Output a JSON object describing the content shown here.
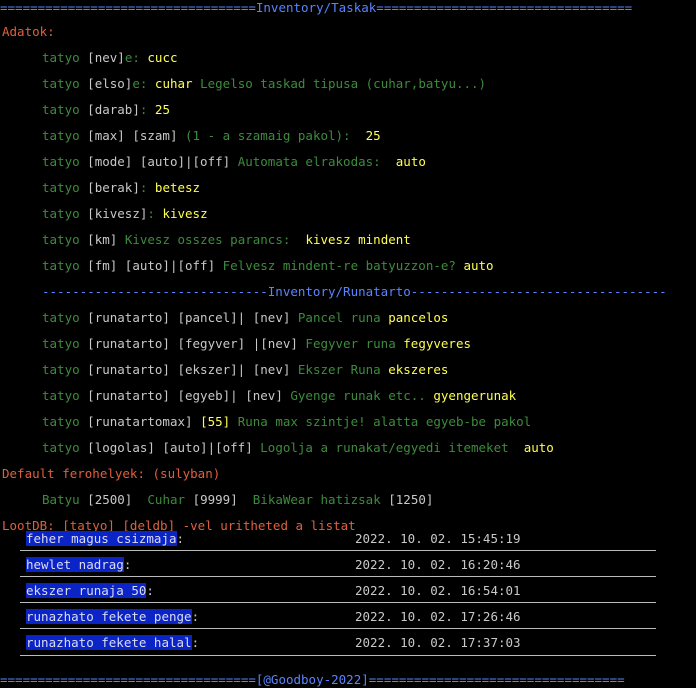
{
  "header": {
    "left_rule": "==================================",
    "title": "Inventory/Taskak",
    "right_rule": "=================================="
  },
  "adatok_label": "Adatok:",
  "commands": [
    {
      "kw": "tatyo",
      "cmd": "[nev]",
      "desc": "e:",
      "value": "cucc"
    },
    {
      "kw": "tatyo",
      "cmd": "[elso]",
      "desc": "e:",
      "value": "cuhar",
      "desc2": "Legelso taskad tipusa (cuhar,batyu...)"
    },
    {
      "kw": "tatyo",
      "cmd": "[darab]",
      "desc": ":",
      "value": "25"
    },
    {
      "kw": "tatyo",
      "cmd": "[max] [szam]",
      "desc": "(1 - a szamaig pakol):",
      "value": "25"
    },
    {
      "kw": "tatyo",
      "cmd": "[mode] [auto]|[off]",
      "desc": "Automata elrakodas:",
      "value": "auto"
    },
    {
      "kw": "tatyo",
      "cmd": "[berak]",
      "desc": ":",
      "value": "betesz"
    },
    {
      "kw": "tatyo",
      "cmd": "[kivesz]",
      "desc": ":",
      "value": "kivesz"
    },
    {
      "kw": "tatyo",
      "cmd": "[km]",
      "desc": "Kivesz osszes parancs:",
      "value": "kivesz mindent"
    },
    {
      "kw": "tatyo",
      "cmd": "[fm] [auto]|[off]",
      "desc": "Felvesz mindent-re batyuzzon-e?",
      "value": "auto"
    }
  ],
  "sub_header": {
    "left_rule": "------------------------------",
    "title": "Inventory/Runatarto",
    "right_rule": "----------------------------------"
  },
  "runa_commands": [
    {
      "kw": "tatyo",
      "cmd": "[runatarto] [pancel]| [nev]",
      "desc": "Pancel runa",
      "value": "pancelos"
    },
    {
      "kw": "tatyo",
      "cmd": "[runatarto] [fegyver] |[nev]",
      "desc": "Fegyver runa",
      "value": "fegyveres"
    },
    {
      "kw": "tatyo",
      "cmd": "[runatarto] [ekszer]| [nev]",
      "desc": "Ekszer Runa",
      "value": "ekszeres"
    },
    {
      "kw": "tatyo",
      "cmd": "[runatarto] [egyeb]| [nev]",
      "desc": "Gyenge runak etc..",
      "value": "gyengerunak"
    },
    {
      "kw": "tatyo",
      "cmd": "[runatartomax]",
      "num": "[55]",
      "desc": "Runa max szintje! alatta egyeb-be pakol"
    },
    {
      "kw": "tatyo",
      "cmd": "[logolas] [auto]|[off]",
      "desc": "Logolja a runakat/egyedi itemeket",
      "value": "auto"
    }
  ],
  "default_label": "Default ferohelyek: (sulyban)",
  "defaults": [
    {
      "name": "Batyu",
      "val": "[2500]"
    },
    {
      "name": "Cuhar",
      "val": "[9999]"
    },
    {
      "name": "BikaWear hatizsak",
      "val": "[1250]"
    }
  ],
  "lootdb_label": "LootDB: [tatyo] [deldb] -vel uritheted a listat",
  "loot": [
    {
      "item": "feher magus csizmaja",
      "time": "2022. 10. 02. 15:45:19"
    },
    {
      "item": "hewlet nadrag",
      "time": "2022. 10. 02. 16:20:46"
    },
    {
      "item": "ekszer runaja 50",
      "time": "2022. 10. 02. 16:54:01"
    },
    {
      "item": "runazhato fekete penge",
      "time": "2022. 10. 02. 17:26:46"
    },
    {
      "item": "runazhato fekete halal",
      "time": "2022. 10. 02. 17:37:03"
    }
  ],
  "footer": {
    "left_rule": "==================================",
    "title": "[@Goodboy-2022]",
    "right_rule": "=================================="
  }
}
